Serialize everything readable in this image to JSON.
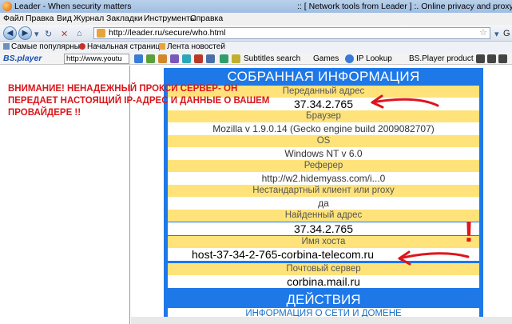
{
  "window": {
    "title_left": "Leader - When security matters",
    "title_right": ":: [ Network tools from Leader ] :. Online privacy and proxy tests"
  },
  "menu": [
    "Файл",
    "Правка",
    "Вид",
    "Журнал",
    "Закладки",
    "Инструменты",
    "Справка"
  ],
  "nav": {
    "url": "http://leader.ru/secure/who.html"
  },
  "bookmarks": [
    {
      "label": "Самые популярные"
    },
    {
      "label": "Начальная страница"
    },
    {
      "label": "Лента новостей"
    }
  ],
  "bsplayer": {
    "logo": "BS.player",
    "url": "http://www.youtu",
    "items": [
      "Subtitles search",
      "Games",
      "IP Lookup",
      "BS.Player product"
    ]
  },
  "warning": "ВНИМАНИЕ! НЕНАДЕЖНЫЙ ПРОКСИ СЕРВЕР- ОН ПЕРЕДАЕТ НАСТОЯЩИЙ IP-АДРЕС И ДАННЫЕ О ВАШЕМ ПРОВАЙДЕРЕ !!",
  "panel": {
    "title": "СОБРАННАЯ ИНФОРМАЦИЯ",
    "rows": [
      {
        "label": "Переданный адрес",
        "value": "37.34.2.765"
      },
      {
        "label": "Браузер",
        "value": "Mozilla v 1.9.0.14 (Gecko engine build 2009082707)"
      },
      {
        "label": "OS",
        "value": "Windows NT v 6.0"
      },
      {
        "label": "Реферер",
        "value": "http://w2.hidemyass.com/i...0"
      },
      {
        "label": "Нестандартный клиент или proxy",
        "value": "да"
      },
      {
        "label": "Найденный адрес",
        "value": "37.34.2.765"
      },
      {
        "label": "Имя хоста",
        "value": "host-37-34-2-765-corbina-telecom.ru"
      },
      {
        "label": "Почтовый сервер",
        "value": "corbina.mail.ru"
      }
    ],
    "actions_title": "ДЕЙСТВИЯ",
    "actions_link": "ИНФОРМАЦИЯ О СЕТИ И ДОМЕНЕ"
  },
  "annotation": {
    "exclamation": "!",
    "color": "#e0141b"
  },
  "colors": {
    "panel_blue": "#1e78e8",
    "row_yellow": "#ffe27a",
    "warning_red": "#d9161c"
  }
}
